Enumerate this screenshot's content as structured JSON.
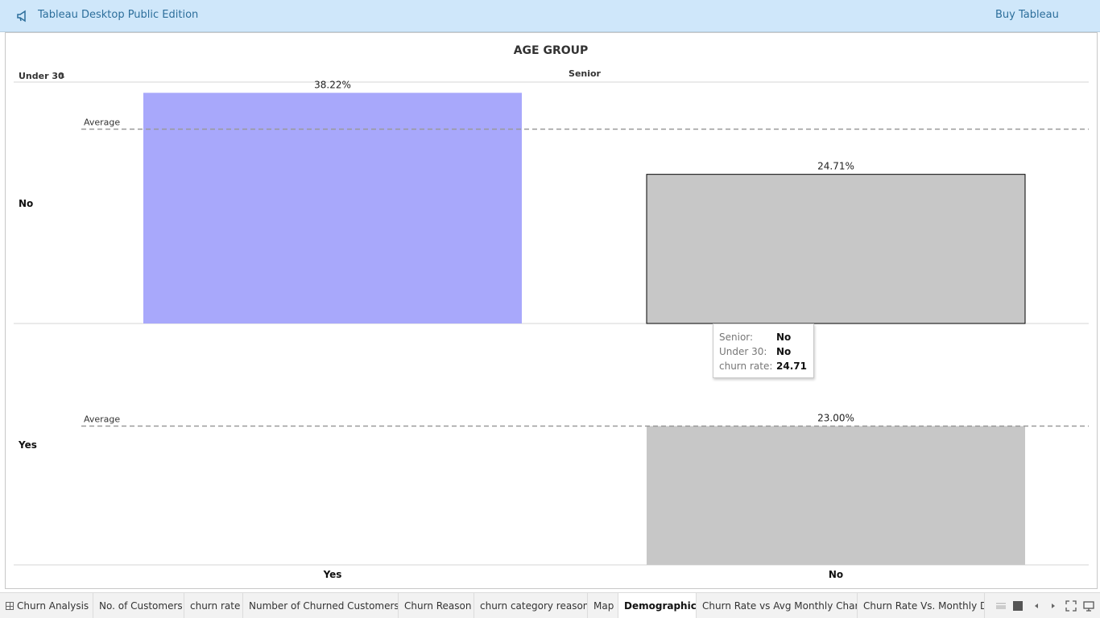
{
  "topbar": {
    "title": "Tableau Desktop Public Edition",
    "buy_label": "Buy Tableau",
    "icon": "megaphone-icon"
  },
  "chart_data": {
    "type": "bar",
    "title": "AGE GROUP",
    "row_header": "Under 30",
    "column_header": "Senior",
    "rows": [
      "No",
      "Yes"
    ],
    "categories": [
      "Yes",
      "No"
    ],
    "value_format": "percent",
    "cells": [
      {
        "under30": "No",
        "senior": "Yes",
        "value": 38.22,
        "label": "38.22%"
      },
      {
        "under30": "No",
        "senior": "No",
        "value": 24.71,
        "label": "24.71%"
      },
      {
        "under30": "Yes",
        "senior": "Yes",
        "value": null,
        "label": ""
      },
      {
        "under30": "Yes",
        "senior": "No",
        "value": 23.0,
        "label": "23.00%"
      }
    ],
    "average_label": "Average",
    "averages": {
      "No": 32.2,
      "Yes": 23.0
    },
    "ylim": [
      0,
      40
    ],
    "colors": {
      "highlight": "#a8a8fb",
      "default": "#c7c7c7",
      "selected_border": "#000000",
      "average_line": "#999999"
    }
  },
  "tooltip": {
    "rows": [
      {
        "key": "Senior:",
        "value": "No"
      },
      {
        "key": "Under 30:",
        "value": "No"
      },
      {
        "key": "churn rate:",
        "value": "24.71"
      }
    ]
  },
  "tabs": [
    {
      "label": "Churn Analysis",
      "icon": "dashboard-grid-icon"
    },
    {
      "label": "No. of Customers"
    },
    {
      "label": "churn rate"
    },
    {
      "label": "Number of Churned Customers"
    },
    {
      "label": "Churn Reason"
    },
    {
      "label": "churn category reason"
    },
    {
      "label": "Map"
    },
    {
      "label": "Demographics",
      "active": true
    },
    {
      "label": "Churn Rate vs Avg Monthly Char..."
    },
    {
      "label": "Churn Rate Vs. Monthly Dat"
    }
  ],
  "controls": [
    "filmstrip-icon",
    "sheet-sorter-icon",
    "previous-icon",
    "next-icon",
    "fullscreen-icon",
    "presentation-icon"
  ]
}
